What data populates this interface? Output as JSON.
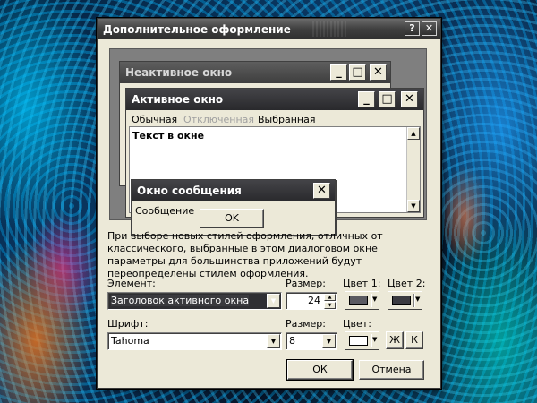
{
  "dialog": {
    "title": "Дополнительное оформление",
    "help": "?",
    "close": "✕"
  },
  "preview": {
    "inactive_title": "Неактивное окно",
    "active_title": "Активное окно",
    "menu": [
      "Обычная",
      "Отключенная",
      "Выбранная"
    ],
    "window_text": "Текст в окне",
    "msg_title": "Окно сообщения",
    "msg_text": "Сообщение",
    "msg_ok": "OK"
  },
  "info_text": "При выборе новых стилей оформления, отличных от классического, выбранные в этом диалоговом окне параметры для большинства приложений будут переопределены стилем оформления.",
  "element": {
    "label": "Элемент:",
    "value": "Заголовок активного окна",
    "size_label": "Размер:",
    "size_value": "24",
    "color1_label": "Цвет 1:",
    "color2_label": "Цвет 2:",
    "color1": "#5a5a62",
    "color2": "#3a3a40"
  },
  "font": {
    "label": "Шрифт:",
    "value": "Tahoma",
    "size_label": "Размер:",
    "size_value": "8",
    "color_label": "Цвет:",
    "color": "#ffffff",
    "bold": "Ж",
    "italic": "К"
  },
  "buttons": {
    "ok": "ОК",
    "cancel": "Отмена"
  },
  "colors": {
    "inactive_title": "#4a4a4a",
    "active_title": "#2f2f33",
    "msg_title": "#2f2f33",
    "disabled_text": "#a0a0a0"
  }
}
